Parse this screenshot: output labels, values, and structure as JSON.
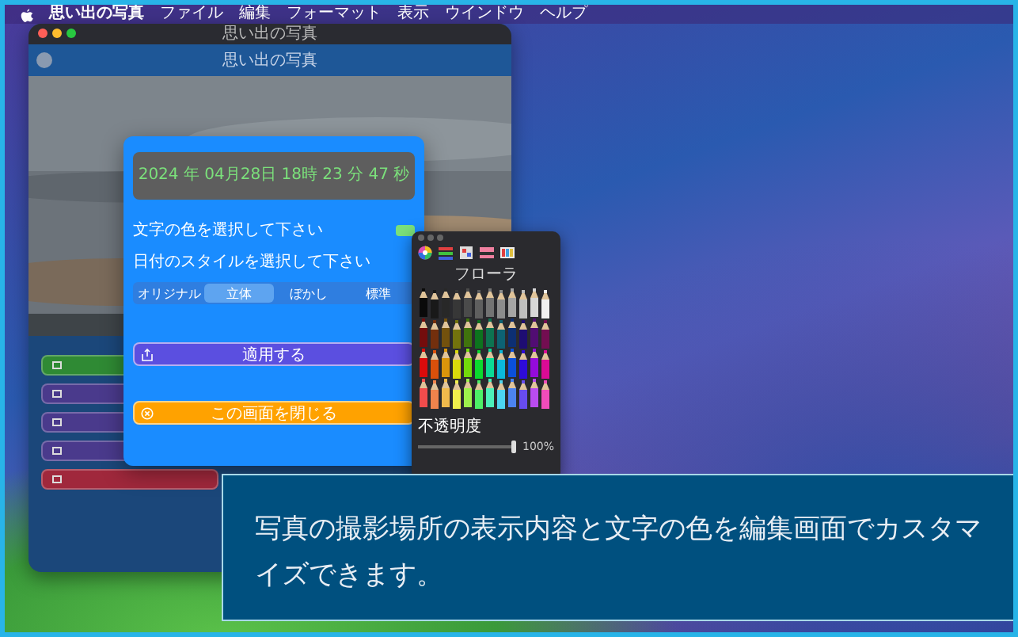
{
  "menu_bar": {
    "items": [
      "思い出の写真",
      "ファイル",
      "編集",
      "フォーマット",
      "表示",
      "ウインドウ",
      "ヘルプ"
    ]
  },
  "window": {
    "title": "思い出の写真",
    "toolbar_title": "思い出の写真",
    "sidebar_buttons": [
      {
        "color": "#2f8a34"
      },
      {
        "color": "#4a3a8c"
      },
      {
        "color": "#4a3a8c"
      },
      {
        "color": "#4a3a8c"
      },
      {
        "color": "#a0283c"
      }
    ]
  },
  "editor_sheet": {
    "date_preview": "2024 年 04月28日 18時 23 分 47 秒",
    "text_color_label": "文字の色を選択して下さい",
    "text_color": {
      "color": "#7be07b"
    },
    "style_label": "日付のスタイルを選択して下さい",
    "styles": [
      {
        "label": "オリジナル",
        "selected": false
      },
      {
        "label": "立体",
        "selected": true
      },
      {
        "label": "ぼかし",
        "selected": false
      },
      {
        "label": "標準",
        "selected": false
      }
    ],
    "apply_button": "適用する",
    "close_button": "この画面を閉じる"
  },
  "color_panel": {
    "palette_name": "フローラ",
    "opacity_label": "不透明度",
    "opacity": {
      "level": 1
    },
    "opacity_reading": "100%"
  },
  "caption": "写真の撮影場所の表示内容と文字の色を編集画面でカスタマイズできます。"
}
